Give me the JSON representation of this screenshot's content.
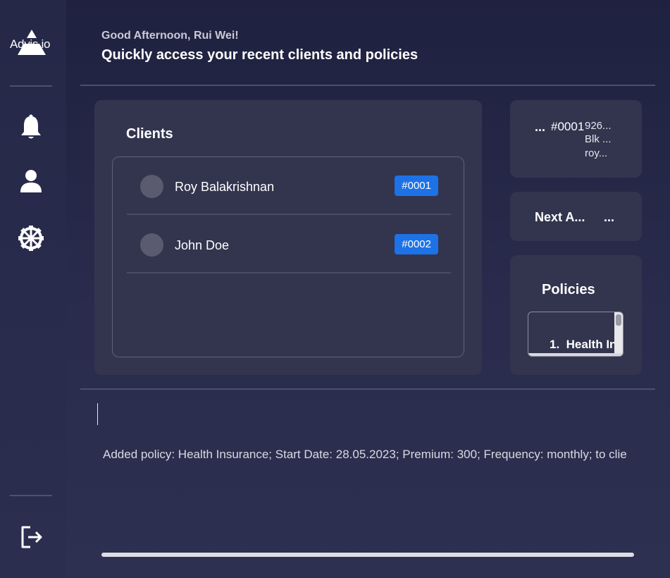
{
  "app": {
    "logo_text": "Advis.io"
  },
  "header": {
    "greeting": "Good Afternoon, Rui Wei!",
    "subtitle": "Quickly access your recent clients and policies"
  },
  "sidebar": {
    "items": [
      {
        "icon": "bell-icon",
        "label": "Notifications"
      },
      {
        "icon": "user-icon",
        "label": "Profile"
      },
      {
        "icon": "gear-icon",
        "label": "Settings"
      }
    ],
    "logout_icon": "logout-icon"
  },
  "clients": {
    "title": "Clients",
    "rows": [
      {
        "name": "Roy Balakrishnan",
        "id": "#0001"
      },
      {
        "name": "John Doe",
        "id": "#0002"
      }
    ]
  },
  "client_detail": {
    "ellipsis": "...",
    "id": "#0001",
    "line1": "926...",
    "line2": "Blk ...",
    "line3": "roy..."
  },
  "next_appointment": {
    "label": "Next A...",
    "value": "..."
  },
  "policies": {
    "title": "Policies",
    "items": [
      {
        "number": "1.",
        "name": "Health In"
      }
    ]
  },
  "command": {
    "result_text": "Added policy: Health Insurance; Start Date: 28.05.2023; Premium: 300; Frequency: monthly;  to clie"
  },
  "colors": {
    "background": "#1f2140",
    "sidebar": "#262848",
    "card": "#33354f",
    "badge": "#1d72e6"
  }
}
